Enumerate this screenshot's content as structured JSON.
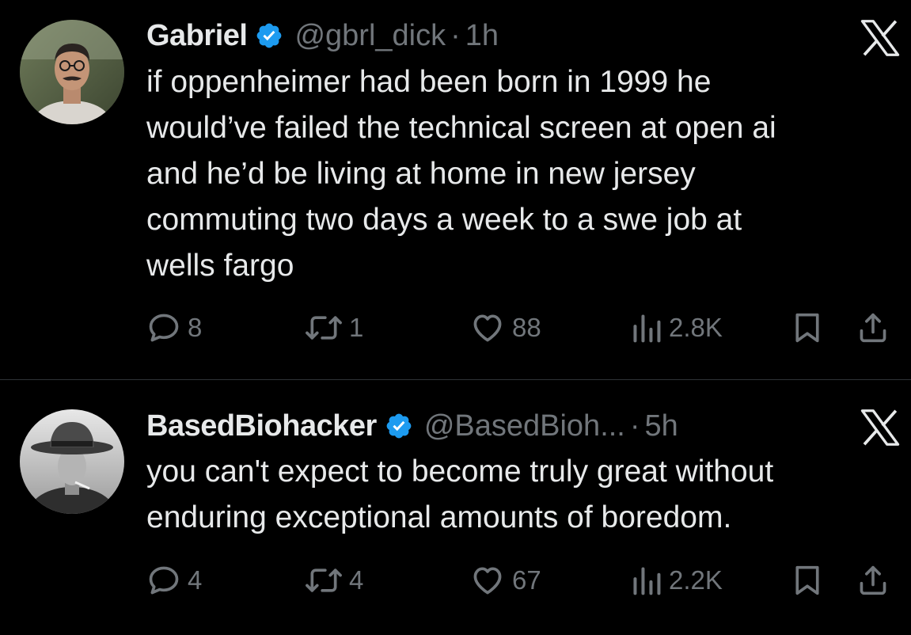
{
  "tweets": [
    {
      "name": "Gabriel",
      "handle": "@gbrl_dick",
      "separator": "·",
      "time": "1h",
      "text_lines": [
        "if oppenheimer had been born in 1999 he",
        "would’ve failed the technical screen at open ai",
        "and he’d be living at home in new jersey",
        "commuting two days a week to a swe job at",
        "wells fargo"
      ],
      "replies": "8",
      "retweets": "1",
      "likes": "88",
      "views": "2.8K",
      "avatar_icon": "user-avatar-photo"
    },
    {
      "name": "BasedBiohacker",
      "handle": "@BasedBioh...",
      "separator": "·",
      "time": "5h",
      "text_lines": [
        "you can't expect to become truly great without",
        "enduring exceptional amounts of boredom."
      ],
      "replies": "4",
      "retweets": "4",
      "likes": "67",
      "views": "2.2K",
      "avatar_icon": "user-avatar-photo"
    }
  ],
  "icons": {
    "verified": "verified-badge-icon",
    "brand": "x-logo-icon",
    "reply": "reply-icon",
    "retweet": "retweet-icon",
    "like": "heart-icon",
    "views": "views-icon",
    "bookmark": "bookmark-icon",
    "share": "share-icon"
  },
  "colors": {
    "background": "#000000",
    "text": "#e7e9ea",
    "secondary": "#71767b",
    "verified": "#1d9bf0",
    "divider": "#2f3336"
  }
}
